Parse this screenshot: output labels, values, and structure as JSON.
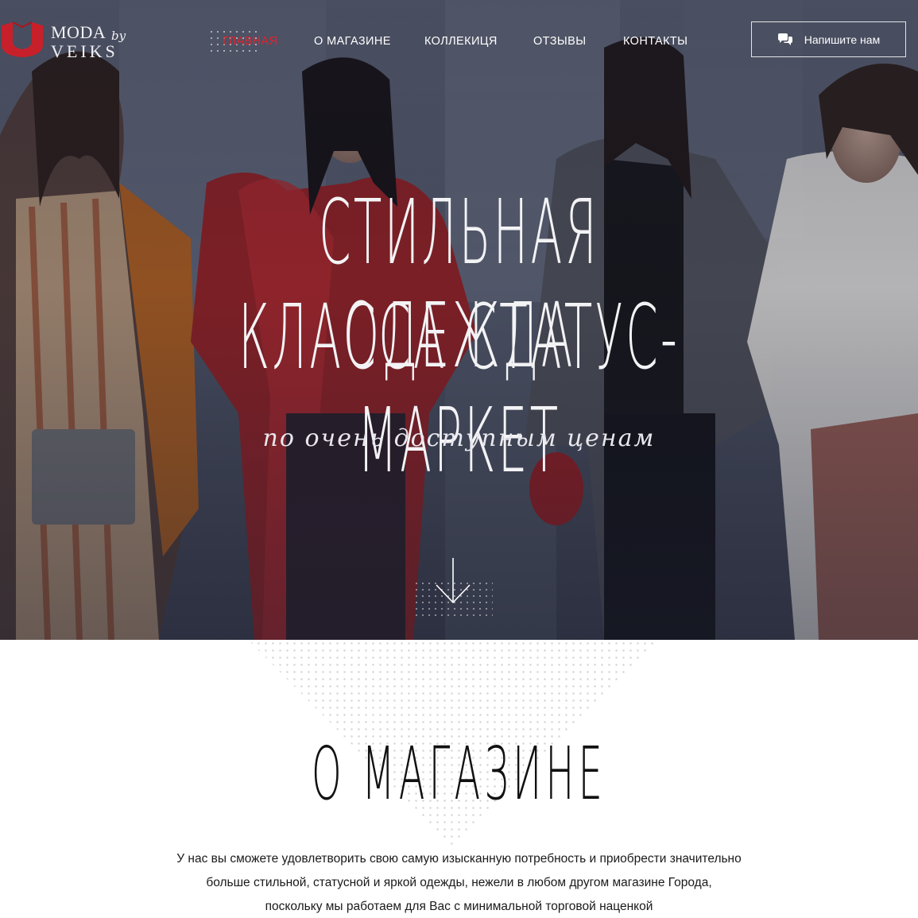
{
  "brand": {
    "line1": "MODA",
    "line2": "VEIKS",
    "by": "by",
    "accent_color": "#c8202a"
  },
  "nav": {
    "items": [
      {
        "label": "ГЛАВНАЯ",
        "active": true
      },
      {
        "label": "О МАГАЗИНЕ",
        "active": false
      },
      {
        "label": "КОЛЛЕКИЦЯ",
        "active": false
      },
      {
        "label": "ОТЗЫВЫ",
        "active": false
      },
      {
        "label": "КОНТАКТЫ",
        "active": false
      }
    ],
    "active_color": "#e0232d"
  },
  "contact_button": {
    "label": "Напишите нам",
    "icon": "chat-bubbles-icon"
  },
  "hero": {
    "headline_line1": "СТИЛЬНАЯ ОДЕЖДА",
    "headline_line2": "КЛАССА СТАТУС-МАРКЕТ",
    "tagline": "по очень доступным ценам",
    "scroll_icon": "arrow-down-icon"
  },
  "about": {
    "title": "О МАГАЗИНЕ",
    "text_line1": "У нас вы сможете удовлетворить свою самую изысканную потребность и приобрести значительно",
    "text_line2": "больше стильной, статусной и яркой одежды, нежели в любом другом магазине Города,",
    "text_line3": "поскольку мы работаем для Вас с минимальной торговой наценкой"
  }
}
